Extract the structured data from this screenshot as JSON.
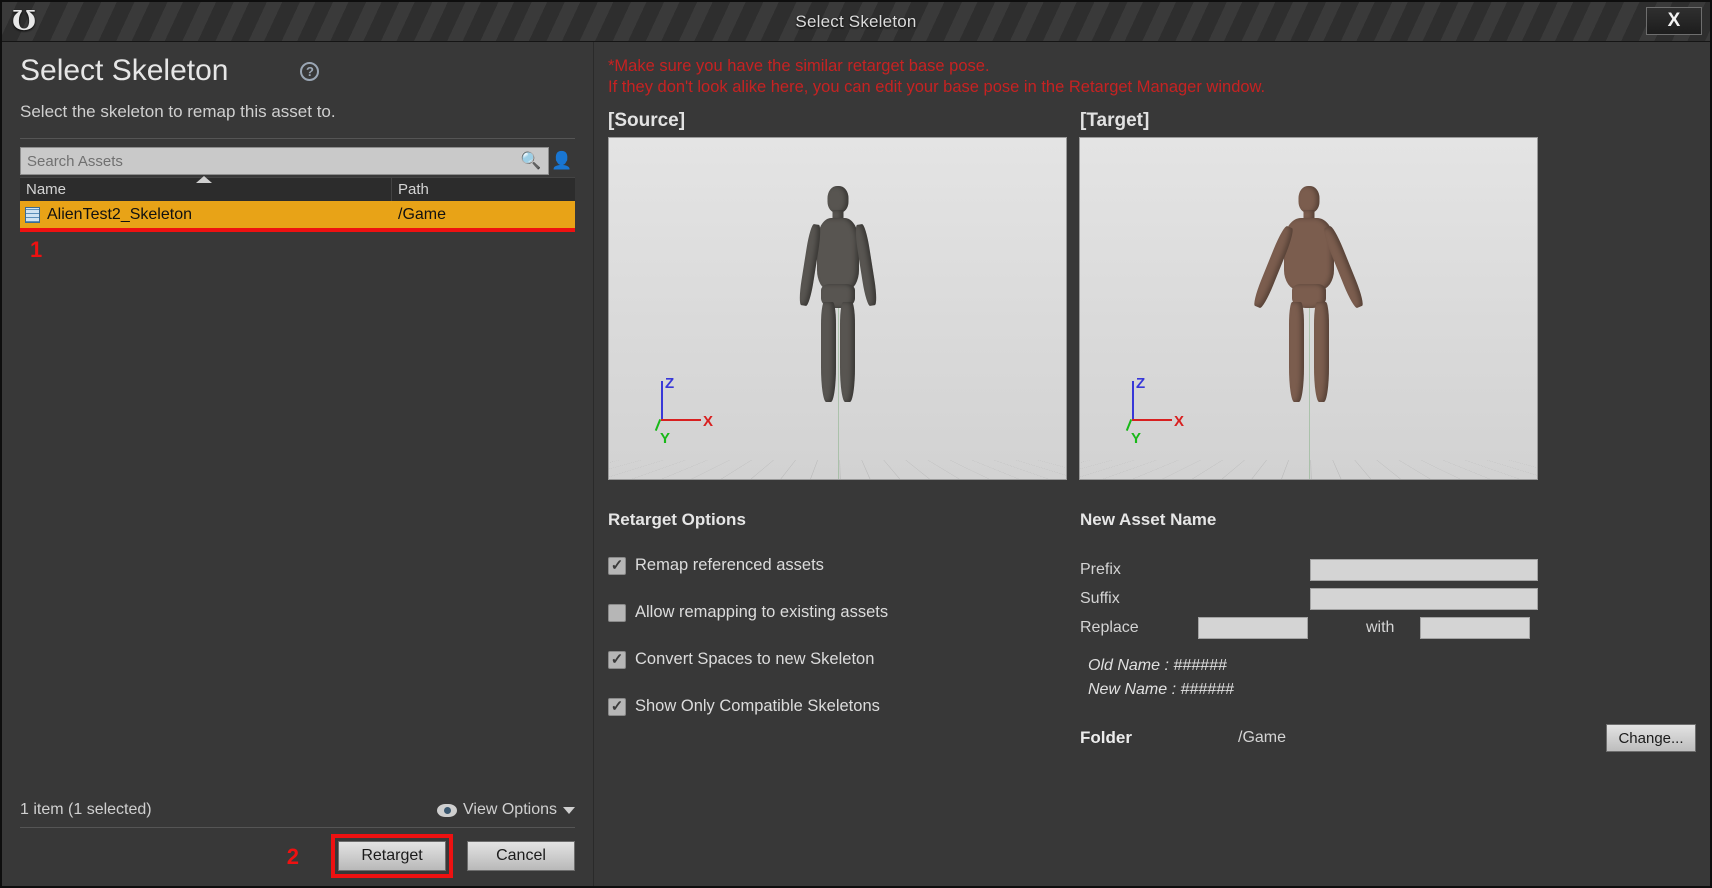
{
  "window": {
    "title": "Select Skeleton",
    "close_label": "X",
    "logo_glyph": "Ʊ"
  },
  "left_panel": {
    "heading": "Select Skeleton",
    "help_icon": "help-circle-icon",
    "subtitle": "Select the skeleton to remap this asset to.",
    "search": {
      "placeholder": "Search Assets",
      "value": "",
      "search_icon": "magnifier-icon",
      "person_icon": "user-filter-icon"
    },
    "table": {
      "columns": [
        "Name",
        "Path"
      ],
      "sort_column": "Name",
      "sort_direction": "ascending",
      "rows": [
        {
          "name": "AlienTest2_Skeleton",
          "path": "/Game",
          "selected": true,
          "icon": "skeleton-asset-icon"
        }
      ]
    },
    "annotations": {
      "step1": "1",
      "step2": "2"
    },
    "status": "1 item (1 selected)",
    "view_options": {
      "label": "View Options",
      "icon": "eye-icon"
    },
    "buttons": {
      "primary": "Retarget",
      "secondary": "Cancel"
    }
  },
  "right_panel": {
    "warning_line1": "*Make sure you have the similar retarget base pose.",
    "warning_line2": "If they don't look alike here, you can edit your base pose in the Retarget Manager window.",
    "warning_color": "#c62222",
    "viewports": [
      {
        "label": "[Source]",
        "gizmo": {
          "x": "X",
          "y": "Y",
          "z": "Z"
        }
      },
      {
        "label": "[Target]",
        "gizmo": {
          "x": "X",
          "y": "Y",
          "z": "Z"
        }
      }
    ],
    "retarget_options": {
      "title": "Retarget Options",
      "items": [
        {
          "label": "Remap referenced assets",
          "checked": true
        },
        {
          "label": "Allow remapping to existing assets",
          "checked": false
        },
        {
          "label": "Convert Spaces to new Skeleton",
          "checked": true
        },
        {
          "label": "Show Only Compatible Skeletons",
          "checked": true
        }
      ]
    },
    "new_asset_name": {
      "title": "New Asset Name",
      "prefix_label": "Prefix",
      "prefix_value": "",
      "suffix_label": "Suffix",
      "suffix_value": "",
      "replace_label": "Replace",
      "replace_value": "",
      "with_label": "with",
      "with_value": "",
      "old_name": "Old Name : ######",
      "new_name": "New Name : ######",
      "folder_label": "Folder",
      "folder_value": "/Game",
      "change_label": "Change..."
    }
  }
}
